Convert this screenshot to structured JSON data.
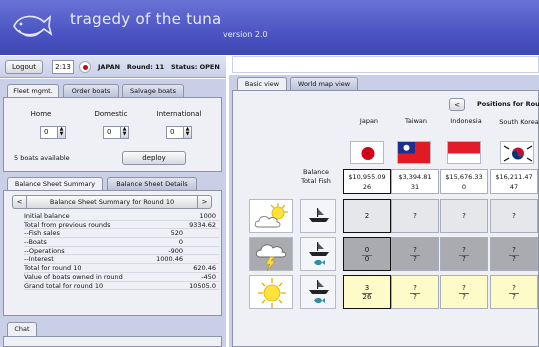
{
  "app": {
    "title": "tragedy of the tuna",
    "version": "version 2.0"
  },
  "statusbar": {
    "logout_label": "Logout",
    "timer": "2:13",
    "country": "JAPAN",
    "round": "Round: 11",
    "status": "Status: OPEN"
  },
  "left_tabs": [
    "Fleet mgmt.",
    "Order boats",
    "Salvage boats"
  ],
  "fleet": {
    "columns": [
      "Home",
      "Domestic",
      "International"
    ],
    "values": [
      "0",
      "0",
      "0"
    ],
    "boats_available": "5 boats available",
    "deploy_label": "deploy"
  },
  "balance_tabs": [
    "Balance Sheet Summary",
    "Balance Sheet Details"
  ],
  "balance": {
    "nav_prev": "<",
    "nav_next": ">",
    "title": "Balance Sheet Summary for Round 10",
    "rows": [
      {
        "label": "Initial balance",
        "v1": "",
        "v2": "1000"
      },
      {
        "label": "Total from previous rounds",
        "v1": "",
        "v2": "9334.62"
      },
      {
        "label": "--Fish sales",
        "v1": "520",
        "v2": ""
      },
      {
        "label": "--Boats",
        "v1": "0",
        "v2": ""
      },
      {
        "label": "--Operations",
        "v1": "-900",
        "v2": ""
      },
      {
        "label": "--Interest",
        "v1": "1000.46",
        "v2": ""
      },
      {
        "label": "Total for round 10",
        "v1": "",
        "v2": "620.46"
      },
      {
        "label": "Value of boats owned in round",
        "v1": "",
        "v2": "-450"
      },
      {
        "label": "Grand total for round 10",
        "v1": "",
        "v2": "10505.0"
      }
    ]
  },
  "chat_tab": "Chat",
  "right_tabs": [
    "Basic view",
    "World map view"
  ],
  "positions": {
    "nav_prev": "<",
    "title": "Positions for Roun"
  },
  "countries": [
    {
      "name": "Japan",
      "flag": "japan",
      "balance": "$10,955.09",
      "fish": "26"
    },
    {
      "name": "Taiwan",
      "flag": "taiwan",
      "balance": "$3,394.81",
      "fish": "31"
    },
    {
      "name": "Indonesia",
      "flag": "indonesia",
      "balance": "$15,676.33",
      "fish": "0"
    },
    {
      "name": "South Korea",
      "flag": "south-korea",
      "balance": "$16,211.47",
      "fish": "47"
    }
  ],
  "balance_row_label": {
    "line1": "Balance",
    "line2": "Total Fish"
  },
  "zones": [
    {
      "weather": "partly-cloudy",
      "bg": "#e6e7ea",
      "has_fish": false,
      "cells": [
        [
          "2",
          ""
        ],
        [
          "?",
          ""
        ],
        [
          "?",
          ""
        ],
        [
          "?",
          ""
        ]
      ]
    },
    {
      "weather": "storm",
      "bg": "#a9abb1",
      "has_fish": true,
      "cells": [
        [
          "0",
          "0"
        ],
        [
          "?",
          "?"
        ],
        [
          "?",
          "?"
        ],
        [
          "?",
          "?"
        ]
      ]
    },
    {
      "weather": "sunny",
      "bg": "#fdfcc9",
      "has_fish": true,
      "cells": [
        [
          "3",
          "26"
        ],
        [
          "?",
          "?"
        ],
        [
          "?",
          "?"
        ],
        [
          "?",
          "?"
        ]
      ]
    }
  ]
}
